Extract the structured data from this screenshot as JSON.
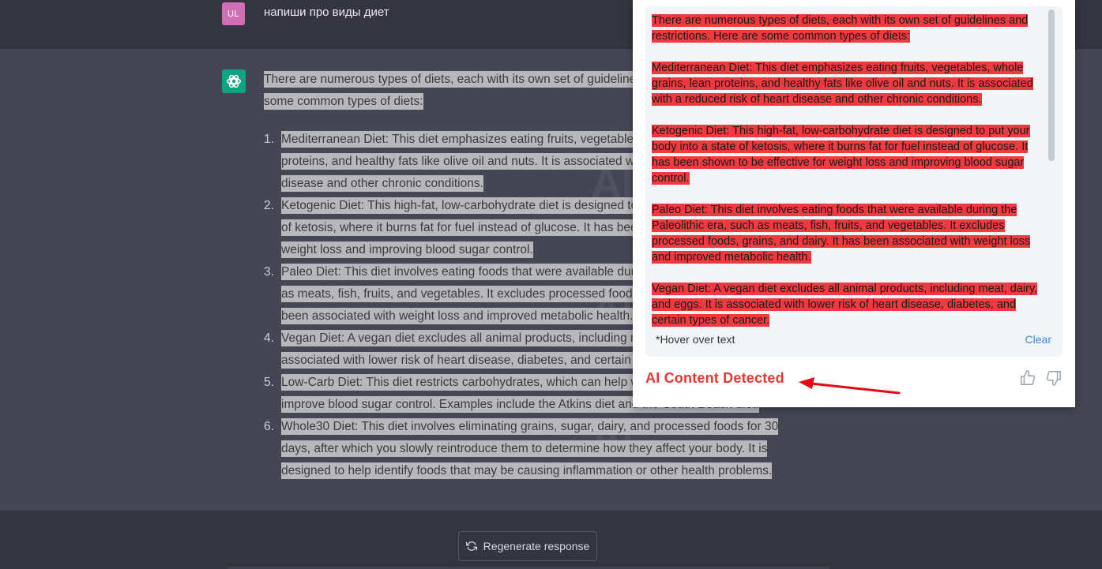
{
  "user_message": {
    "avatar_initials": "UL",
    "text": "напиши про виды диет"
  },
  "assistant": {
    "intro": "There are numerous types of diets, each with its own set of guidelines and restrictions. Here are some common types of diets:",
    "items": [
      {
        "num": "1.",
        "text": "Mediterranean Diet: This diet emphasizes eating fruits, vegetables, whole grains, lean proteins, and healthy fats like olive oil and nuts. It is associated with a reduced risk of heart disease and other chronic conditions."
      },
      {
        "num": "2.",
        "text": "Ketogenic Diet: This high-fat, low-carbohydrate diet is designed to put your body into a state of ketosis, where it burns fat for fuel instead of glucose. It has been shown to be effective for weight loss and improving blood sugar control."
      },
      {
        "num": "3.",
        "text": "Paleo Diet: This diet involves eating foods that were available during the Paleolithic era, such as meats, fish, fruits, and vegetables. It excludes processed foods, grains, and dairy. It has been associated with weight loss and improved metabolic health."
      },
      {
        "num": "4.",
        "text": "Vegan Diet: A vegan diet excludes all animal products, including meat, dairy, and eggs. It is associated with lower risk of heart disease, diabetes, and certain types of cancer."
      },
      {
        "num": "5.",
        "text": "Low-Carb Diet: This diet restricts carbohydrates, which can help with weight loss and improve blood sugar control. Examples include the Atkins diet and the South Beach diet."
      },
      {
        "num": "6.",
        "text": "Whole30 Diet: This diet involves eliminating grains, sugar, dairy, and processed foods for 30 days, after which you slowly reintroduce them to determine how they affect your body. It is designed to help identify foods that may be causing inflammation or other health problems."
      }
    ]
  },
  "regenerate_label": "Regenerate response",
  "detector": {
    "paragraphs": [
      "There are numerous types of diets, each with its own set of guidelines and restrictions. Here are some common types of diets:",
      "Mediterranean Diet: This diet emphasizes eating fruits, vegetables, whole grains, lean proteins, and healthy fats like olive oil and nuts. It is associated with a reduced risk of heart disease and other chronic conditions.",
      "Ketogenic Diet: This high-fat, low-carbohydrate diet is designed to put your body into a state of ketosis, where it burns fat for fuel instead of glucose. It has been shown to be effective for weight loss and improving blood sugar control.",
      "Paleo Diet: This diet involves eating foods that were available during the Paleolithic era, such as meats, fish, fruits, and vegetables. It excludes processed foods, grains, and dairy. It has been associated with weight loss and improved metabolic health.",
      "Vegan Diet: A vegan diet excludes all animal products, including meat, dairy, and eggs. It is associated with lower risk of heart disease, diabetes, and certain types of cancer."
    ],
    "hover_note": "*Hover over text",
    "clear_label": "Clear",
    "status": "AI Content Detected",
    "icons": {
      "thumbs_up": "thumbs-up-icon",
      "thumbs_down": "thumbs-down-icon"
    }
  },
  "colors": {
    "highlight_red": "#ef3b3f",
    "status_red": "#e53935",
    "link_blue": "#3a8ad8",
    "gpt_green": "#10a37f",
    "user_avatar": "#d06fb6"
  }
}
